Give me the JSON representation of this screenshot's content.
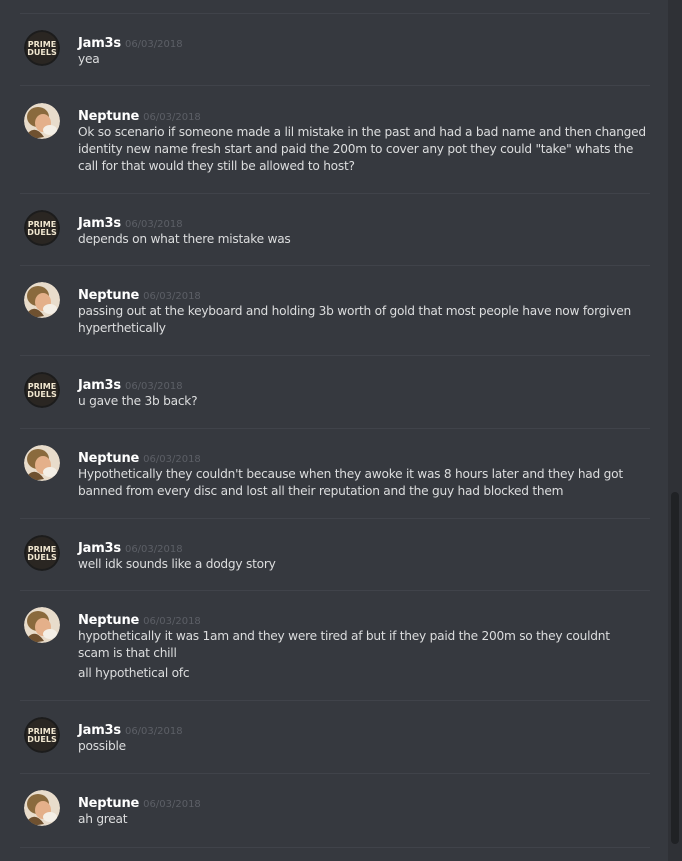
{
  "messages": [
    {
      "author": "Jam3s",
      "timestamp": "06/03/2018",
      "avatar": "prime-duels-logo-icon",
      "avatar_text": [
        "PRIME",
        "DUELS"
      ],
      "lines": [
        "yea"
      ]
    },
    {
      "author": "Neptune",
      "timestamp": "06/03/2018",
      "avatar": "neptune-photo-avatar-icon",
      "lines": [
        "Ok so scenario if someone made a lil mistake in the past and had a bad name and then changed identity new name fresh start and paid the 200m to cover any pot they could \"take\" whats the call for that would they still be allowed to host?"
      ]
    },
    {
      "author": "Jam3s",
      "timestamp": "06/03/2018",
      "avatar": "prime-duels-logo-icon",
      "avatar_text": [
        "PRIME",
        "DUELS"
      ],
      "lines": [
        "depends on what there mistake was"
      ]
    },
    {
      "author": "Neptune",
      "timestamp": "06/03/2018",
      "avatar": "neptune-photo-avatar-icon",
      "lines": [
        "passing out at the keyboard and holding 3b worth of gold that most people have now forgiven hyperthetically"
      ]
    },
    {
      "author": "Jam3s",
      "timestamp": "06/03/2018",
      "avatar": "prime-duels-logo-icon",
      "avatar_text": [
        "PRIME",
        "DUELS"
      ],
      "lines": [
        "u gave the 3b back?"
      ]
    },
    {
      "author": "Neptune",
      "timestamp": "06/03/2018",
      "avatar": "neptune-photo-avatar-icon",
      "lines": [
        "Hypothetically they couldn't because when they awoke it was 8 hours later and they had got banned from every disc and lost all their reputation and the guy had blocked them"
      ]
    },
    {
      "author": "Jam3s",
      "timestamp": "06/03/2018",
      "avatar": "prime-duels-logo-icon",
      "avatar_text": [
        "PRIME",
        "DUELS"
      ],
      "lines": [
        "well idk sounds like a dodgy story"
      ]
    },
    {
      "author": "Neptune",
      "timestamp": "06/03/2018",
      "avatar": "neptune-photo-avatar-icon",
      "lines": [
        "hypothetically it was 1am and they were tired af but if they paid the 200m so they couldnt scam is that chill",
        "all hypothetical ofc"
      ]
    },
    {
      "author": "Jam3s",
      "timestamp": "06/03/2018",
      "avatar": "prime-duels-logo-icon",
      "avatar_text": [
        "PRIME",
        "DUELS"
      ],
      "lines": [
        "possible"
      ]
    },
    {
      "author": "Neptune",
      "timestamp": "06/03/2018",
      "avatar": "neptune-photo-avatar-icon",
      "lines": [
        "ah great"
      ]
    }
  ],
  "colors": {
    "background": "#36393f",
    "username": "#ffffff",
    "timestamp": "#5c5f66",
    "message_text": "#dcddde",
    "divider": "#40434a",
    "scrollbar_thumb": "#202225"
  }
}
